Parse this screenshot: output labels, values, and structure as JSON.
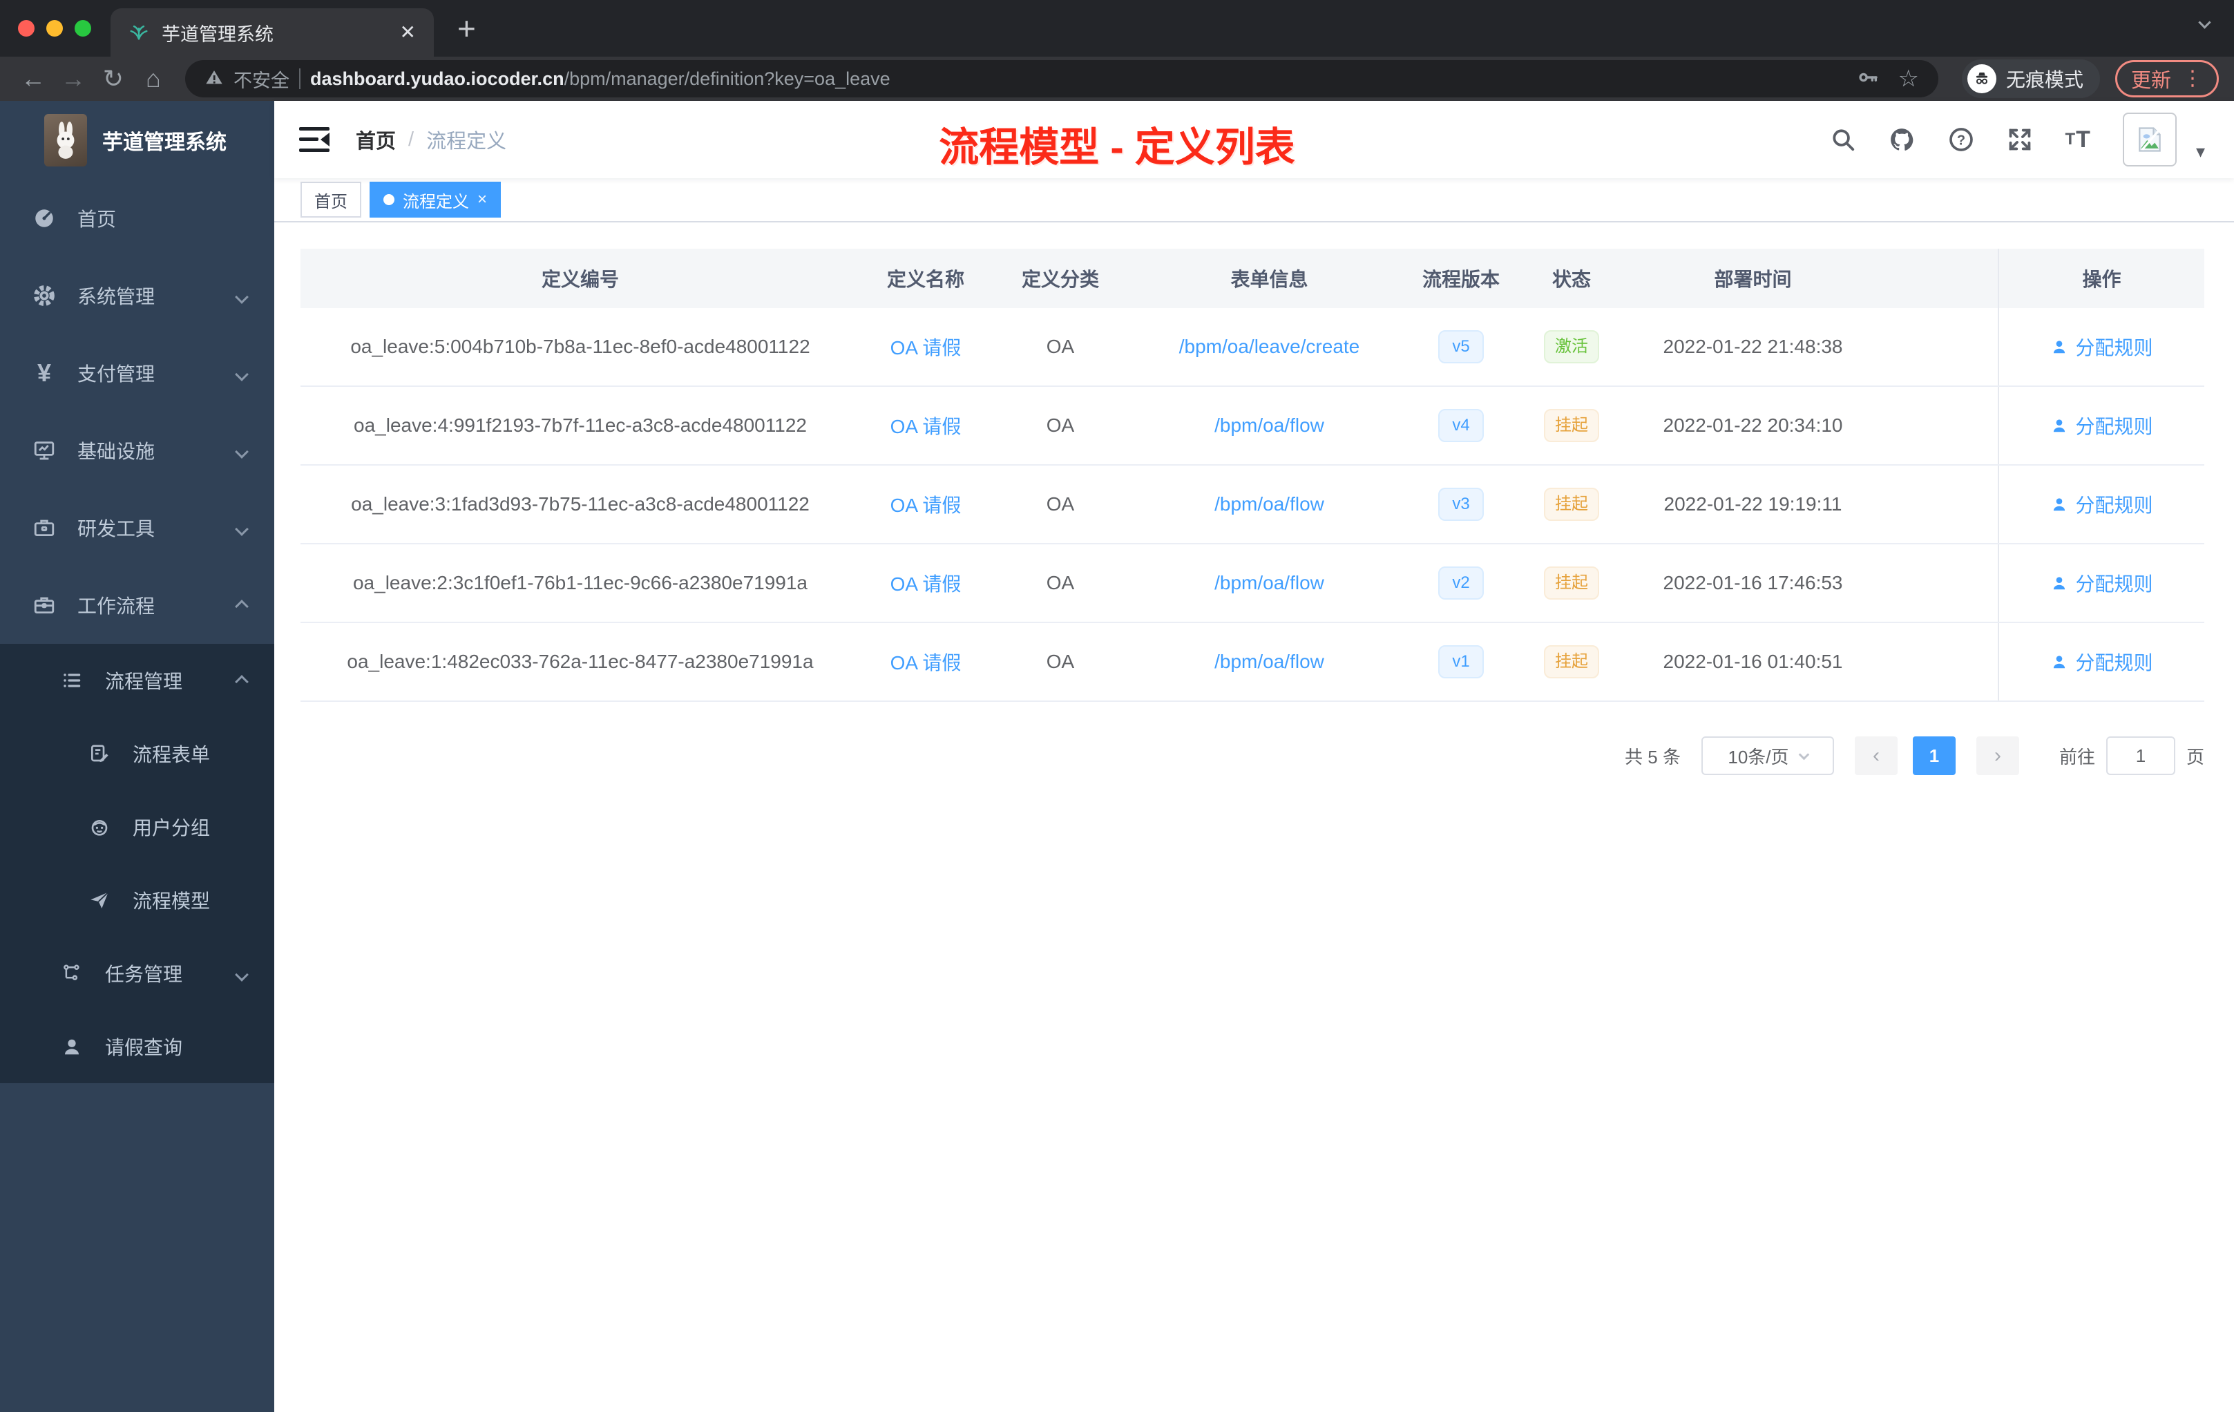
{
  "browser": {
    "tab_title": "芋道管理系统",
    "not_secure_label": "不安全",
    "url_host": "dashboard.yudao.iocoder.cn",
    "url_path": "/bpm/manager/definition?key=oa_leave",
    "incognito_label": "无痕模式",
    "update_label": "更新"
  },
  "icons": {
    "back": "←",
    "forward": "→",
    "reload": "↻",
    "home": "⌂",
    "star": "☆",
    "plus": "+",
    "tab_close": "✕",
    "tag_close": "×",
    "kebab": "⋮",
    "avatar_caret": "▾",
    "breadcrumb_sep": "/",
    "prev": "‹",
    "next": "›",
    "yen": "¥",
    "fontsize_small": "T",
    "fontsize_big": "T",
    "help_mark": "?"
  },
  "sidebar": {
    "logo_title": "芋道管理系统",
    "home": "首页",
    "system": "系统管理",
    "pay": "支付管理",
    "infra": "基础设施",
    "dev": "研发工具",
    "workflow": "工作流程",
    "process_mgmt": "流程管理",
    "process_form": "流程表单",
    "user_group": "用户分组",
    "process_model": "流程模型",
    "task_mgmt": "任务管理",
    "leave_query": "请假查询"
  },
  "header": {
    "breadcrumb_home": "首页",
    "breadcrumb_current": "流程定义",
    "overlay_title": "流程模型 - 定义列表"
  },
  "tags": {
    "home": "首页",
    "active": "流程定义"
  },
  "table": {
    "columns": [
      "定义编号",
      "定义名称",
      "定义分类",
      "表单信息",
      "流程版本",
      "状态",
      "部署时间",
      "操作"
    ],
    "rows": [
      {
        "id": "oa_leave:5:004b710b-7b8a-11ec-8ef0-acde48001122",
        "name": "OA 请假",
        "category": "OA",
        "form": "/bpm/oa/leave/create",
        "version": "v5",
        "status": "激活",
        "status_type": "active",
        "deploy_time": "2022-01-22 21:48:38",
        "action": "分配规则"
      },
      {
        "id": "oa_leave:4:991f2193-7b7f-11ec-a3c8-acde48001122",
        "name": "OA 请假",
        "category": "OA",
        "form": "/bpm/oa/flow",
        "version": "v4",
        "status": "挂起",
        "status_type": "suspended",
        "deploy_time": "2022-01-22 20:34:10",
        "action": "分配规则"
      },
      {
        "id": "oa_leave:3:1fad3d93-7b75-11ec-a3c8-acde48001122",
        "name": "OA 请假",
        "category": "OA",
        "form": "/bpm/oa/flow",
        "version": "v3",
        "status": "挂起",
        "status_type": "suspended",
        "deploy_time": "2022-01-22 19:19:11",
        "action": "分配规则"
      },
      {
        "id": "oa_leave:2:3c1f0ef1-76b1-11ec-9c66-a2380e71991a",
        "name": "OA 请假",
        "category": "OA",
        "form": "/bpm/oa/flow",
        "version": "v2",
        "status": "挂起",
        "status_type": "suspended",
        "deploy_time": "2022-01-16 17:46:53",
        "action": "分配规则"
      },
      {
        "id": "oa_leave:1:482ec033-762a-11ec-8477-a2380e71991a",
        "name": "OA 请假",
        "category": "OA",
        "form": "/bpm/oa/flow",
        "version": "v1",
        "status": "挂起",
        "status_type": "suspended",
        "deploy_time": "2022-01-16 01:40:51",
        "action": "分配规则"
      }
    ]
  },
  "pagination": {
    "total_label": "共 5 条",
    "page_size": "10条/页",
    "current_page": "1",
    "goto_label": "前往",
    "goto_value": "1",
    "page_unit": "页"
  },
  "colors": {
    "accent_blue": "#409eff",
    "success_green": "#67c23a",
    "warning_yellow": "#e6a23c",
    "title_red": "#fb2a18",
    "sidebar_bg": "#304156",
    "submenu_bg": "#1f2d3d"
  }
}
